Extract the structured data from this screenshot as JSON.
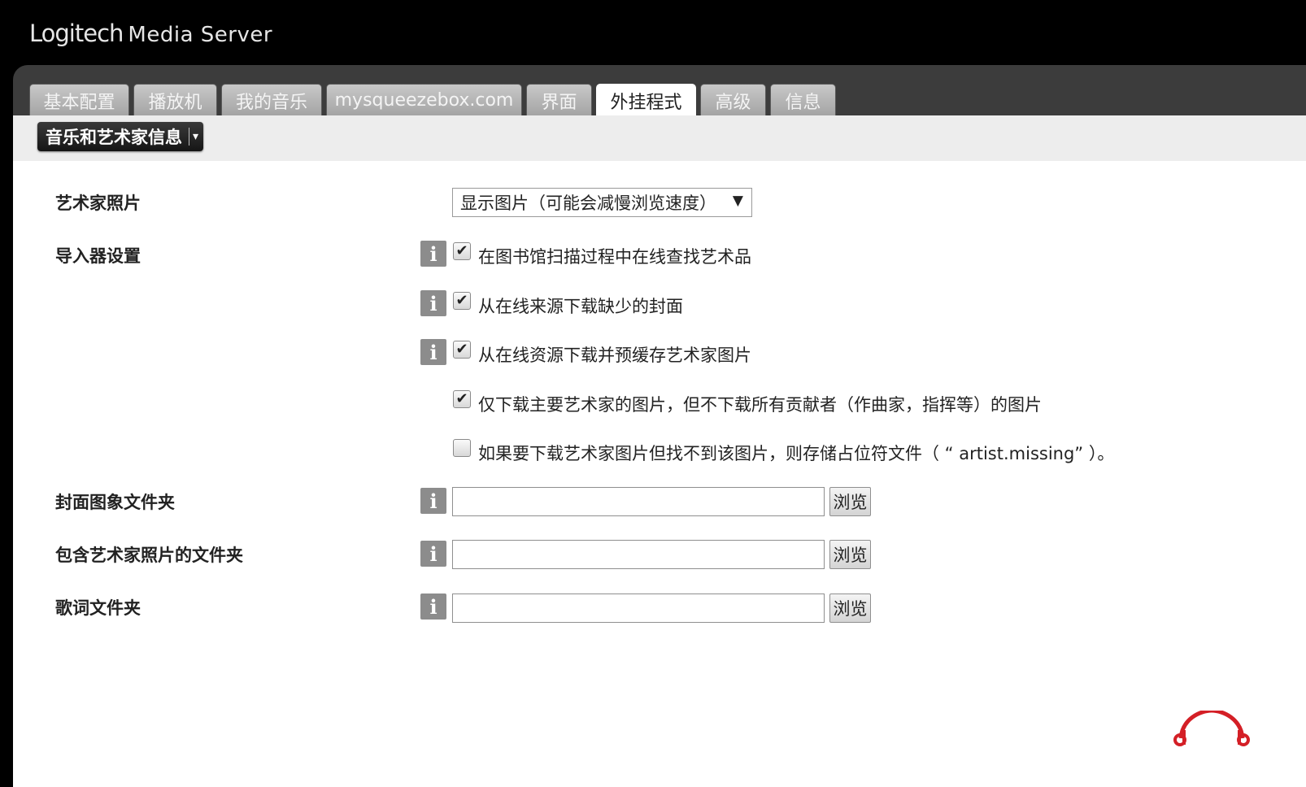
{
  "app": {
    "brand": "Logitech",
    "product": "Media Server"
  },
  "tabs": [
    {
      "label": "基本配置"
    },
    {
      "label": "播放机"
    },
    {
      "label": "我的音乐"
    },
    {
      "label": "mysqueezebox.com"
    },
    {
      "label": "界面"
    },
    {
      "label": "外挂程式",
      "active": true
    },
    {
      "label": "高级"
    },
    {
      "label": "信息"
    }
  ],
  "section_menu": {
    "selected": "音乐和艺术家信息"
  },
  "settings": {
    "artist_photos": {
      "label": "艺术家照片",
      "selected": "显示图片（可能会减慢浏览速度）"
    },
    "importer": {
      "label": "导入器设置",
      "options": [
        {
          "text": "在图书馆扫描过程中在线查找艺术品",
          "checked": true
        },
        {
          "text": "从在线来源下载缺少的封面",
          "checked": true
        },
        {
          "text": "从在线资源下载并预缓存艺术家图片",
          "checked": true
        },
        {
          "text": "仅下载主要艺术家的图片，但不下载所有贡献者（作曲家，指挥等）的图片",
          "checked": true
        },
        {
          "text": "如果要下载艺术家图片但找不到该图片，则存储占位符文件（ “ artist.missing” ）。",
          "checked": false
        }
      ]
    },
    "cover_folder": {
      "label": "封面图象文件夹",
      "value": "",
      "browse": "浏览"
    },
    "artist_photo_folder": {
      "label": "包含艺术家照片的文件夹",
      "value": "",
      "browse": "浏览"
    },
    "lyrics_folder": {
      "label": "歌词文件夹",
      "value": "",
      "browse": "浏览"
    }
  },
  "icons": {
    "info": "i",
    "checkmark": "✔",
    "select_arrow": "▼",
    "caret": "▾"
  }
}
